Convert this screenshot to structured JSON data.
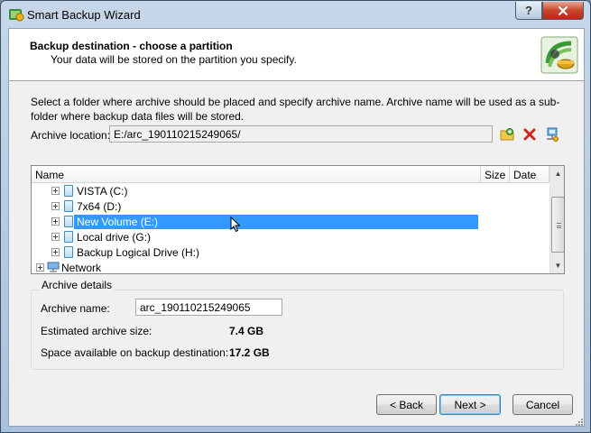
{
  "window": {
    "title": "Smart Backup Wizard",
    "help_label": "?"
  },
  "header": {
    "title": "Backup destination - choose a partition",
    "subtitle": "Your data will be stored on the partition you specify."
  },
  "instructions": "Select a folder where archive should be placed and specify archive name. Archive name will be used as a sub-folder where backup data files will be stored.",
  "archive_location": {
    "label": "Archive location:",
    "value": "E:/arc_190110215249065/"
  },
  "tree": {
    "columns": [
      "Name",
      "Size",
      "Date"
    ],
    "items": [
      {
        "label": "VISTA (C:)"
      },
      {
        "label": "7x64 (D:)"
      },
      {
        "label": "New Volume (E:)",
        "selected": true
      },
      {
        "label": "Local drive (G:)"
      },
      {
        "label": "Backup Logical Drive (H:)"
      },
      {
        "label": "Network"
      }
    ]
  },
  "details": {
    "group_title": "Archive details",
    "name_label": "Archive name:",
    "name_value": "arc_190110215249065",
    "estimated_label": "Estimated archive size:",
    "estimated_value": "7.4 GB",
    "space_label": "Space available on backup destination:",
    "space_value": "17.2 GB"
  },
  "buttons": {
    "back": "< Back",
    "next": "Next >",
    "cancel": "Cancel"
  },
  "colors": {
    "selection": "#3399ff",
    "close_button": "#c9462c"
  }
}
